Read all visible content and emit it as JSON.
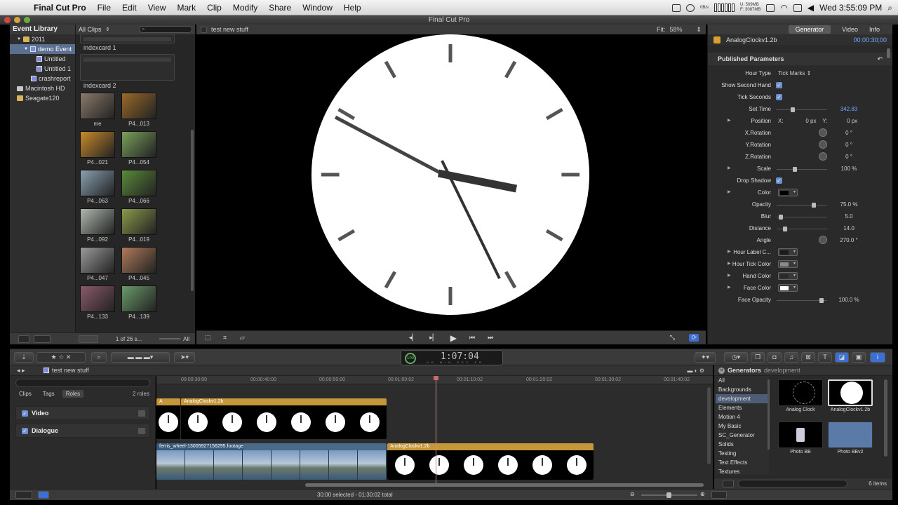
{
  "menubar": {
    "app_name": "Final Cut Pro",
    "items": [
      "File",
      "Edit",
      "View",
      "Mark",
      "Clip",
      "Modify",
      "Share",
      "Window",
      "Help"
    ],
    "clock": "Wed 3:55:09 PM",
    "net_up": "U: 509MB",
    "net_down": "F: 3087MB",
    "net_rate": "0B/s"
  },
  "window": {
    "title": "Final Cut Pro"
  },
  "event_library": {
    "header": "Event Library",
    "items": [
      {
        "label": "2011",
        "type": "folder"
      },
      {
        "label": "demo Event",
        "type": "event",
        "selected": true
      },
      {
        "label": "Untitled",
        "type": "event"
      },
      {
        "label": "Untitled 1",
        "type": "event"
      },
      {
        "label": "crashreport",
        "type": "event"
      },
      {
        "label": "Macintosh HD",
        "type": "disk"
      },
      {
        "label": "Seagate120",
        "type": "disk"
      }
    ]
  },
  "browser": {
    "filter": "All Clips",
    "indexcards": [
      "indexcard 1",
      "indexcard 2"
    ],
    "thumbs": [
      {
        "label": "me",
        "color": "#8a7a6a"
      },
      {
        "label": "P4...013",
        "color": "#9a6a2a"
      },
      {
        "label": "P4...021",
        "color": "#c98a2a"
      },
      {
        "label": "P4...054",
        "color": "#7aa05a"
      },
      {
        "label": "P4...063",
        "color": "#8aa0b0"
      },
      {
        "label": "P4...066",
        "color": "#5a8a3a"
      },
      {
        "label": "P4...092",
        "color": "#b0b8b0"
      },
      {
        "label": "P4...019",
        "color": "#8a9a4a"
      },
      {
        "label": "P4...047",
        "color": "#9a9a9a"
      },
      {
        "label": "P4...045",
        "color": "#b07a5a"
      },
      {
        "label": "P4...133",
        "color": "#8a5a6a"
      },
      {
        "label": "P4...139",
        "color": "#6a9a6a"
      }
    ],
    "footer_count": "1 of 26 s...",
    "footer_filter": "All"
  },
  "viewer": {
    "project": "test new stuff",
    "fit_label": "Fit:",
    "fit_value": "58%"
  },
  "inspector": {
    "tabs": [
      "Generator",
      "Video",
      "Info"
    ],
    "active_tab": "Generator",
    "clip_name": "AnalogClockv1.2b",
    "clip_tc": "00:00:30;00",
    "section": "Published Parameters",
    "params": [
      {
        "label": "Hour Type",
        "kind": "popup",
        "value": "Tick Marks ⇕"
      },
      {
        "label": "Show Second Hand",
        "kind": "check"
      },
      {
        "label": "Tick Seconds",
        "kind": "check"
      },
      {
        "label": "Set Time",
        "kind": "slider",
        "value": "342.83",
        "pos": 0.3,
        "blue": true
      },
      {
        "label": "Position",
        "kind": "xy",
        "tri": true,
        "x": "0",
        "y": "0",
        "unit": "px"
      },
      {
        "label": "X.Rotation",
        "kind": "dial",
        "value": "0 °"
      },
      {
        "label": "Y.Rotation",
        "kind": "dial",
        "value": "0 °"
      },
      {
        "label": "Z.Rotation",
        "kind": "dial",
        "value": "0 °"
      },
      {
        "label": "Scale",
        "kind": "slider",
        "value": "100 %",
        "pos": 0.35,
        "tri": true
      },
      {
        "label": "Drop Shadow",
        "kind": "check"
      },
      {
        "label": "Color",
        "kind": "swatch",
        "tri": true,
        "color": "#000000"
      },
      {
        "label": "Opacity",
        "kind": "slider",
        "value": "75.0  %",
        "pos": 0.75
      },
      {
        "label": "Blur",
        "kind": "slider",
        "value": "5.0",
        "pos": 0.05
      },
      {
        "label": "Distance",
        "kind": "slider",
        "value": "14.0",
        "pos": 0.14
      },
      {
        "label": "Angle",
        "kind": "dial",
        "value": "270.0 °"
      },
      {
        "label": "Hour Label C...",
        "kind": "swatch",
        "tri": true,
        "color": "#1a1a1a"
      },
      {
        "label": "Hour Tick Color",
        "kind": "swatch",
        "tri": true,
        "color": "#8a8a8a"
      },
      {
        "label": "Hand Color",
        "kind": "swatch",
        "tri": true,
        "color": "#2a2a2a"
      },
      {
        "label": "Face Color",
        "kind": "swatch",
        "tri": true,
        "color": "#ffffff"
      },
      {
        "label": "Face Opacity",
        "kind": "slider",
        "value": "100.0  %",
        "pos": 0.92
      }
    ]
  },
  "toolbar": {
    "timecode": "1:07:04",
    "timecode_units": "HR MIN SEC FR",
    "pct": "100"
  },
  "timeline": {
    "project": "test new stuff",
    "ruler": [
      "00:00:30:00",
      "00:00:40:00",
      "00:00:50:00",
      "00:01:00:02",
      "00:01:10:02",
      "00:01:20:02",
      "00:01:30:02",
      "00:01:40:02"
    ],
    "clips": {
      "top_a": "A",
      "top_b": "AnalogClockv1.2b",
      "video": "ferris_wheel-13005927156295.footage",
      "bottom": "AnalogClockv1.2b"
    }
  },
  "roles_pane": {
    "tabs": [
      "Clips",
      "Tags",
      "Roles"
    ],
    "active_tab": "Roles",
    "count": "2 roles",
    "roles": [
      "Video",
      "Dialogue"
    ]
  },
  "generators": {
    "title": "Generators",
    "subtitle": "development",
    "categories": [
      "All",
      "Backgrounds",
      "development",
      "Elements",
      "Motion 4",
      "My Basic",
      "SC_Generator",
      "Solids",
      "Testing",
      "Text Effects",
      "Textures"
    ],
    "selected_category": "development",
    "items": [
      "Analog Clock",
      "AnalogClockv1.2b",
      "Photo BB",
      "Photo BBv2"
    ],
    "count": "6 items"
  },
  "status": {
    "selection": "30:00 selected - 01:30:02 total"
  },
  "colors": {
    "clip_gold": "#c6973a",
    "selection_blue": "#5b6f91",
    "timecode_blue": "#6fa8ff"
  }
}
